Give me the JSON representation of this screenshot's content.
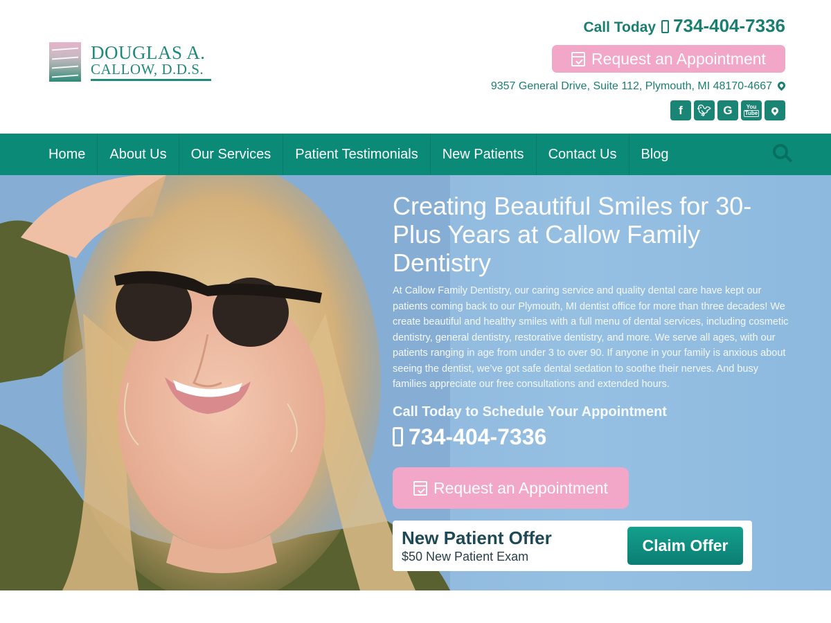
{
  "brand": {
    "name_line1": "DOUGLAS A.",
    "name_line2": "CALLOW, D.D.S."
  },
  "header": {
    "call_label": "Call Today",
    "phone": "734-404-7336",
    "appointment_button": "Request an Appointment",
    "address": "9357 General Drive, Suite 112, Plymouth, MI 48170-4667",
    "socials": [
      {
        "icon": "facebook-icon",
        "glyph": "f"
      },
      {
        "icon": "twitter-icon",
        "glyph": "✓"
      },
      {
        "icon": "google-icon",
        "glyph": "G"
      },
      {
        "icon": "youtube-icon",
        "glyph_top": "You",
        "glyph_bottom": "Tube"
      },
      {
        "icon": "map-pin-icon",
        "glyph": ""
      }
    ]
  },
  "nav": {
    "items": [
      "Home",
      "About Us",
      "Our Services",
      "Patient Testimonials",
      "New Patients",
      "Contact Us",
      "Blog"
    ]
  },
  "hero": {
    "title": "Creating Beautiful Smiles for 30-Plus Years at Callow Family Dentistry",
    "body": "At Callow Family Dentistry, our caring service and quality dental care have kept our patients coming back to our Plymouth, MI dentist office for more than three decades! We create beautiful and healthy smiles with a full menu of dental services, including cosmetic dentistry, general dentistry, restorative dentistry, and more. We serve all ages, with our patients ranging in age from under 3 to over 90. If anyone in your family is anxious about seeing the dentist, we’ve got safe dental sedation to soothe their nerves. And busy families appreciate our free consultations and extended hours.",
    "call_heading": "Call Today to Schedule Your Appointment",
    "phone": "734-404-7336",
    "appointment_button": "Request an Appointment"
  },
  "offer": {
    "title": "New Patient Offer",
    "subtitle": "$50 New Patient Exam",
    "button": "Claim Offer"
  },
  "colors": {
    "brand_teal": "#0c8a78",
    "accent_pink": "#f2a6c8",
    "offer_text": "#1f4a55"
  }
}
